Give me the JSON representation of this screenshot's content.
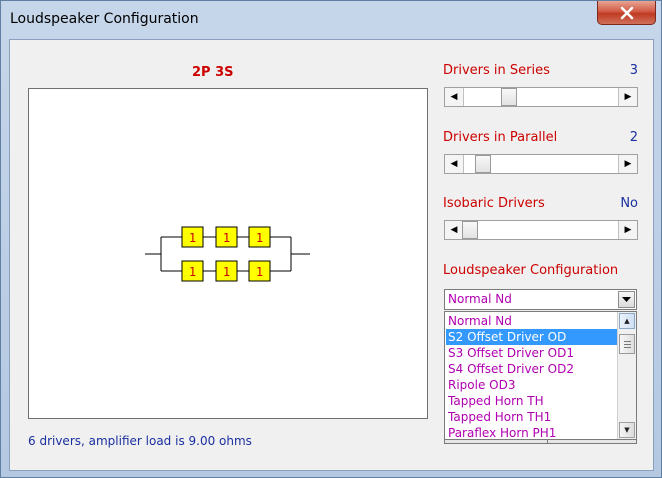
{
  "window": {
    "title": "Loudspeaker Configuration"
  },
  "diagram": {
    "heading": "2P 3S",
    "rows": [
      [
        "1",
        "1",
        "1"
      ],
      [
        "1",
        "1",
        "1"
      ]
    ],
    "box_fill": "#ffff00",
    "box_text_color": "#cc0000"
  },
  "footer": {
    "status": "6 drivers, amplifier load is 9.00 ohms"
  },
  "controls": {
    "series": {
      "label": "Drivers in Series",
      "value": "3"
    },
    "parallel": {
      "label": "Drivers in Parallel",
      "value": "2"
    },
    "isobaric": {
      "label": "Isobaric Drivers",
      "value": "No"
    },
    "config": {
      "label": "Loudspeaker Configuration",
      "selected": "Normal Nd",
      "options": [
        "Normal Nd",
        "S2 Offset Driver OD",
        "S3 Offset Driver OD1",
        "S4 Offset Driver OD2",
        "Ripole OD3",
        "Tapped Horn TH",
        "Tapped Horn TH1",
        "Paraflex Horn PH1"
      ],
      "highlighted_index": 1
    }
  },
  "colors": {
    "label_red": "#cc0000",
    "value_blue": "#1a2fa0",
    "option_magenta": "#b000b0",
    "selection_blue": "#3399ff"
  },
  "icons": {
    "close": "close-icon",
    "left_arrow": "left-arrow-icon",
    "right_arrow": "right-arrow-icon",
    "dropdown": "chevron-down-icon",
    "scroll_up": "scroll-up-icon",
    "scroll_down": "scroll-down-icon"
  }
}
